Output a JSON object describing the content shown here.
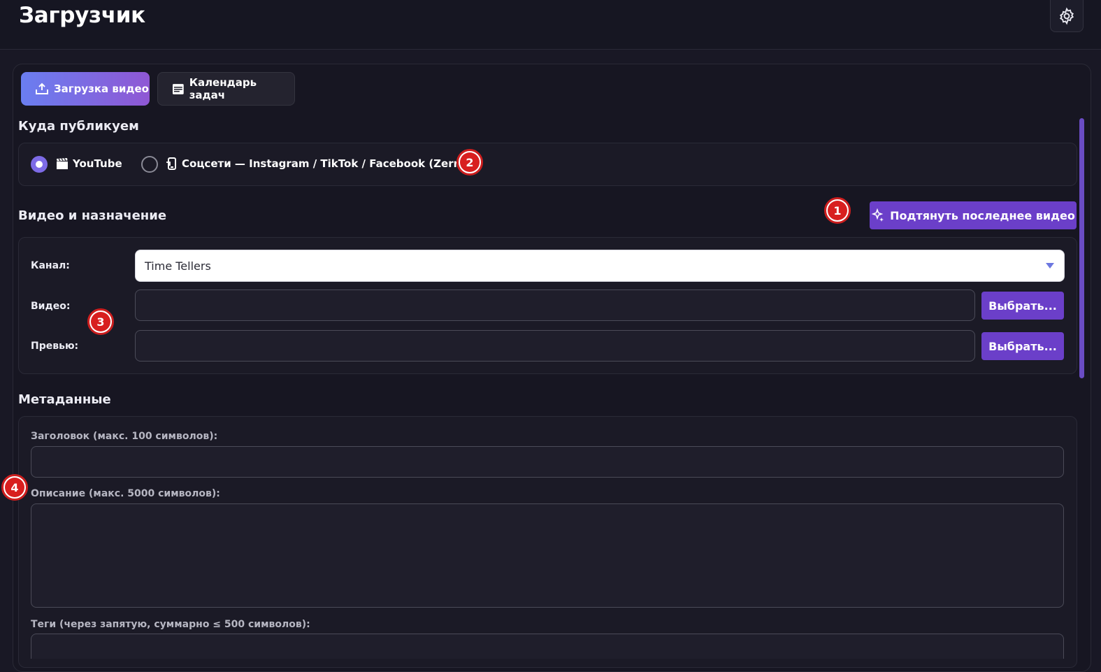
{
  "app": {
    "title": "Загрузчик"
  },
  "tabs": [
    {
      "label": "Загрузка видео",
      "icon": "upload-tray-icon",
      "active": true
    },
    {
      "label": "Календарь задач",
      "icon": "calendar-icon",
      "active": false
    }
  ],
  "publish": {
    "title": "Куда публикуем",
    "options": [
      {
        "label": "YouTube",
        "icon": "clapperboard-icon",
        "selected": true
      },
      {
        "label": "Соцсети — Instagram / TikTok / Facebook (Zernio)",
        "icon": "phone-icon",
        "selected": false
      }
    ]
  },
  "video_section": {
    "title": "Видео и назначение",
    "pull_button": "Подтянуть последнее видео",
    "channel_label": "Канал:",
    "channel_value": "Time Tellers",
    "video_label": "Видео:",
    "video_value": "",
    "preview_label": "Превью:",
    "preview_value": "",
    "choose_label": "Выбрать..."
  },
  "metadata": {
    "title": "Метаданные",
    "title_label": "Заголовок (макс. 100 символов):",
    "title_value": "",
    "description_label": "Описание (макс. 5000 символов):",
    "description_value": "",
    "tags_label": "Теги (через запятую, суммарно ≤ 500 символов):",
    "tags_value": ""
  },
  "annotations": [
    "1",
    "2",
    "3",
    "4"
  ],
  "colors": {
    "background": "#191825",
    "accent": "#6b3fc9",
    "tab_gradient_start": "#6a7ef0",
    "tab_gradient_end": "#8f57d4",
    "annotation_red": "#d81f1f"
  }
}
